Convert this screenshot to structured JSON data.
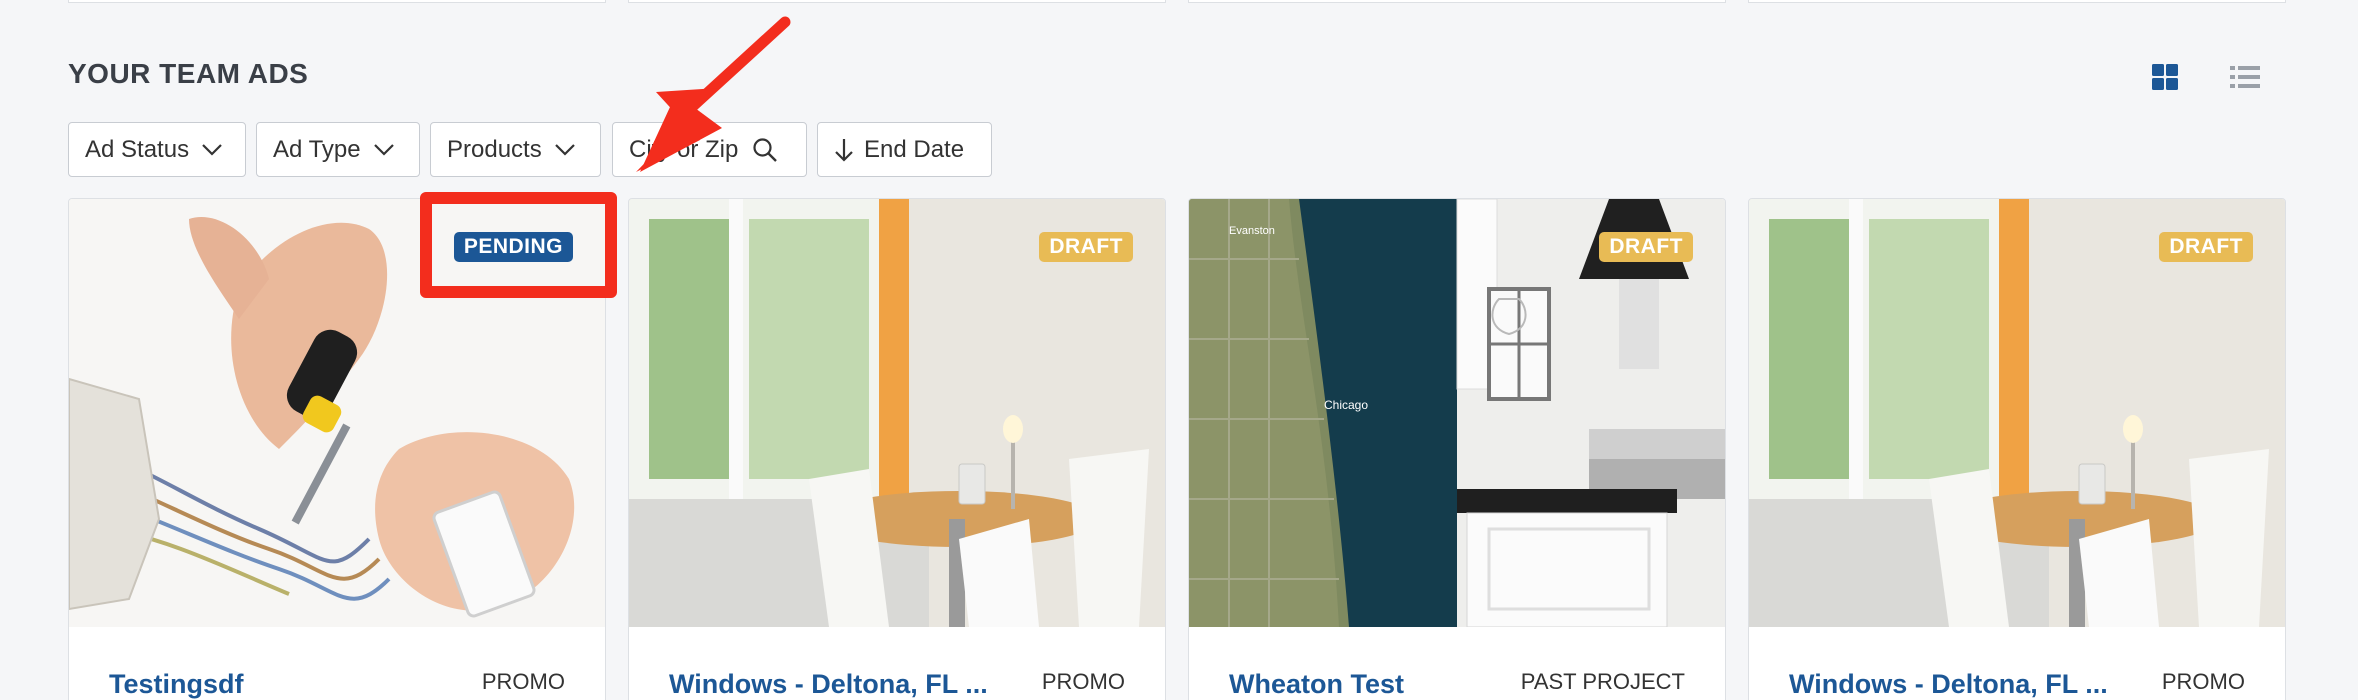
{
  "section": {
    "title": "YOUR TEAM ADS"
  },
  "view_toggle": {
    "active": "grid"
  },
  "filters": {
    "ad_status": "Ad Status",
    "ad_type": "Ad Type",
    "products": "Products",
    "city_zip_placeholder": "City or Zip",
    "end_date": "End Date"
  },
  "ads": [
    {
      "title": "Testingsdf",
      "type": "PROMO",
      "status": "PENDING",
      "image": "electrician-hands-wiring-outlet"
    },
    {
      "title": "Windows - Deltona, FL ...",
      "type": "PROMO",
      "status": "DRAFT",
      "image": "dining-room-windows"
    },
    {
      "title": "Wheaton Test",
      "type": "PAST PROJECT",
      "status": "DRAFT",
      "image": "chicago-satellite-map-and-kitchen"
    },
    {
      "title": "Windows - Deltona, FL ...",
      "type": "PROMO",
      "status": "DRAFT",
      "image": "dining-room-windows"
    }
  ],
  "map_labels": {
    "city": "Chicago",
    "north": "Evanston"
  },
  "colors": {
    "brand_blue": "#1c5796",
    "draft_badge": "#e8bb55",
    "annotation_red": "#f32d1d",
    "background": "#f5f6f8"
  }
}
